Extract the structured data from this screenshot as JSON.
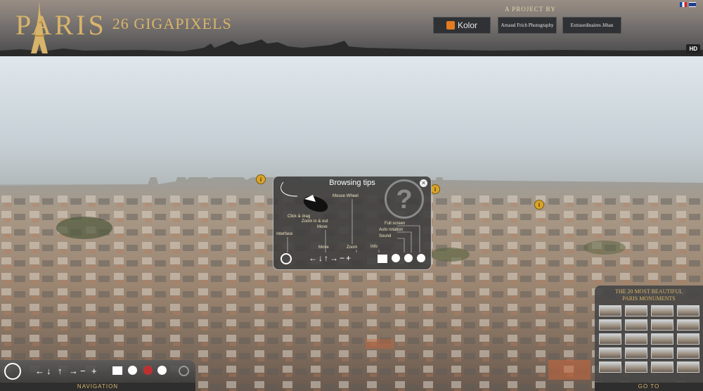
{
  "header": {
    "logo_main": "PARIS",
    "logo_sub": "26 GIGAPIXELS",
    "project_label": "A PROJECT BY",
    "sponsors": [
      "Kolor",
      "Arnaud Frich Photography",
      "Extraordinaires Jéhan"
    ],
    "hd_label": "HD"
  },
  "tips": {
    "title": "Browsing tips",
    "close_glyph": "×",
    "labels": [
      "Mouse Wheel",
      "Click & drag",
      "Zoom in & out",
      "Move",
      "Interface",
      "Move",
      "Zoom",
      "Full screen",
      "Auto rotation",
      "Sound",
      "Info"
    ],
    "help_glyph": "?"
  },
  "markers": [
    "i",
    "i",
    "i"
  ],
  "navigation": {
    "label": "NAVIGATION",
    "controls": [
      "←",
      "↓",
      "↑",
      "→",
      "−",
      "+"
    ]
  },
  "monuments": {
    "title_line1": "THE 20 MOST BEAUTIFUL",
    "title_line2": "PARIS MONUMENTS",
    "goto_label": "GO TO"
  },
  "colors": {
    "gold": "#d8b46a",
    "panel": "#3c3c3c"
  }
}
